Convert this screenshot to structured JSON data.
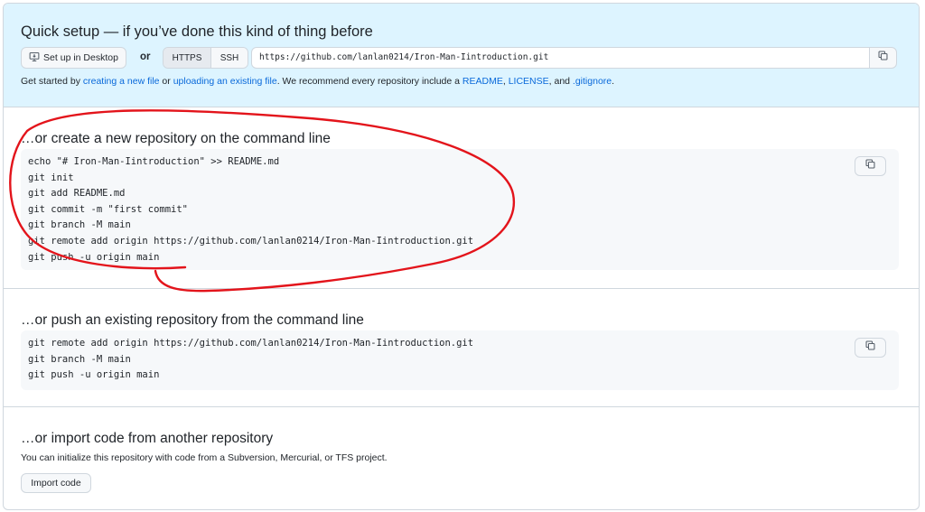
{
  "quick_setup": {
    "title": "Quick setup — if you’ve done this kind of thing before",
    "desktop_button": "Set up in Desktop",
    "or_label": "or",
    "protocols": [
      "HTTPS",
      "SSH"
    ],
    "active_protocol": "HTTPS",
    "repo_url": "https://github.com/lanlan0214/Iron-Man-Iintroduction.git",
    "get_started": {
      "prefix": "Get started by ",
      "link1": "creating a new file",
      "mid1": " or ",
      "link2": "uploading an existing file",
      "mid2": ". We recommend every repository include a ",
      "link3": "README",
      "sep1": ", ",
      "link4": "LICENSE",
      "sep2": ", and ",
      "link5": ".gitignore",
      "suffix": "."
    }
  },
  "create_new": {
    "title": "…or create a new repository on the command line",
    "code": "echo \"# Iron-Man-Iintroduction\" >> README.md\ngit init\ngit add README.md\ngit commit -m \"first commit\"\ngit branch -M main\ngit remote add origin https://github.com/lanlan0214/Iron-Man-Iintroduction.git\ngit push -u origin main"
  },
  "push_existing": {
    "title": "…or push an existing repository from the command line",
    "code": "git remote add origin https://github.com/lanlan0214/Iron-Man-Iintroduction.git\ngit branch -M main\ngit push -u origin main"
  },
  "import": {
    "title": "…or import code from another repository",
    "description": "You can initialize this repository with code from a Subversion, Mercurial, or TFS project.",
    "button": "Import code"
  },
  "icons": {
    "desktop": "desktop-icon",
    "copy": "copy-icon"
  },
  "colors": {
    "accent_link": "#0969da",
    "quick_setup_bg": "#ddf4ff",
    "annotation": "#e3141b"
  }
}
